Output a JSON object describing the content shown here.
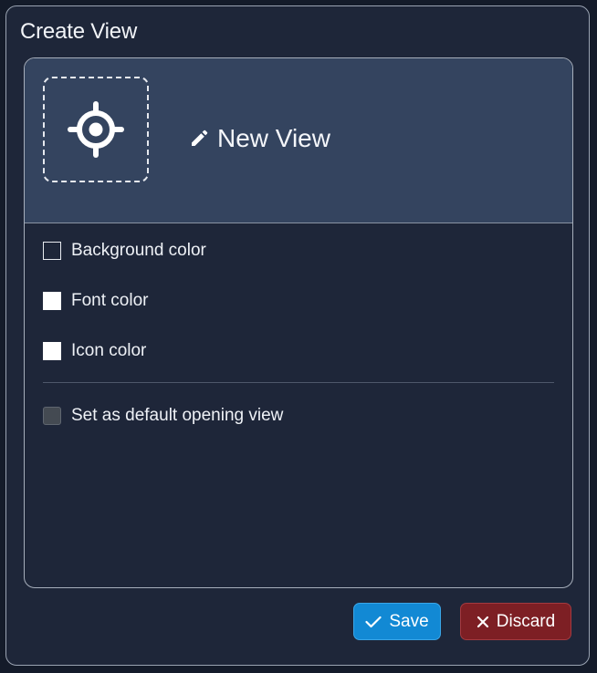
{
  "dialog": {
    "title": "Create View"
  },
  "view": {
    "icon": "crosshair-icon",
    "edit_icon": "pencil-icon",
    "name": "New View"
  },
  "options": {
    "background_color_label": "Background color",
    "font_color_label": "Font color",
    "icon_color_label": "Icon color",
    "default_view_label": "Set as default opening view",
    "default_view_checked": false
  },
  "colors": {
    "background_color": "#1e2639",
    "font_color": "#ffffff",
    "icon_color": "#ffffff",
    "header_bg": "#34445f",
    "save_bg": "#1289d4",
    "discard_bg": "#7d1f24"
  },
  "buttons": {
    "save_label": "Save",
    "save_icon": "check-icon",
    "discard_label": "Discard",
    "discard_icon": "close-icon"
  }
}
